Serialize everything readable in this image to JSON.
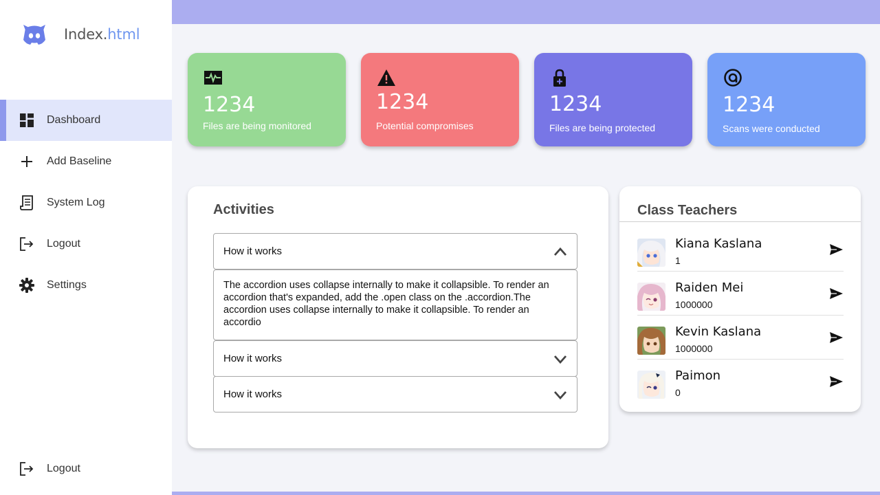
{
  "brand": {
    "name_main": "Index.",
    "name_accent": "html"
  },
  "sidebar": {
    "items": [
      {
        "label": "Dashboard",
        "icon": "grid-icon",
        "active": true
      },
      {
        "label": "Add Baseline",
        "icon": "plus-icon"
      },
      {
        "label": "System Log",
        "icon": "log-icon"
      },
      {
        "label": "Logout",
        "icon": "logout-icon"
      },
      {
        "label": "Settings",
        "icon": "gear-icon"
      }
    ],
    "bottom": {
      "label": "Logout",
      "icon": "logout-icon"
    }
  },
  "colors": {
    "topbar": "#abadf0",
    "green": "#97d994",
    "red": "#f4797d",
    "purple": "#7876e6",
    "blue": "#77a0f8",
    "active": "#e1e6fb"
  },
  "cards": [
    {
      "value": "1234",
      "label": "Files are being monitored",
      "icon": "pulse-icon"
    },
    {
      "value": "1234",
      "label": "Potential compromises",
      "icon": "warning-icon"
    },
    {
      "value": "1234",
      "label": "Files are being protected",
      "icon": "lock-icon"
    },
    {
      "value": "1234",
      "label": "Scans were conducted",
      "icon": "target-icon"
    }
  ],
  "activities": {
    "title": "Activities",
    "items": [
      {
        "title": "How it works",
        "expanded": true,
        "body": "The accordion uses collapse internally to make it collapsible. To render an accordion that's expanded, add the .open class on the .accordion.The accordion uses collapse internally to make it collapsible. To render an accordio"
      },
      {
        "title": "How it works",
        "expanded": false
      },
      {
        "title": "How it works",
        "expanded": false
      }
    ]
  },
  "teachers": {
    "title": "Class Teachers",
    "items": [
      {
        "name": "Kiana Kaslana",
        "value": "1"
      },
      {
        "name": "Raiden Mei",
        "value": "1000000"
      },
      {
        "name": "Kevin Kaslana",
        "value": "1000000"
      },
      {
        "name": "Paimon",
        "value": "0"
      }
    ]
  }
}
